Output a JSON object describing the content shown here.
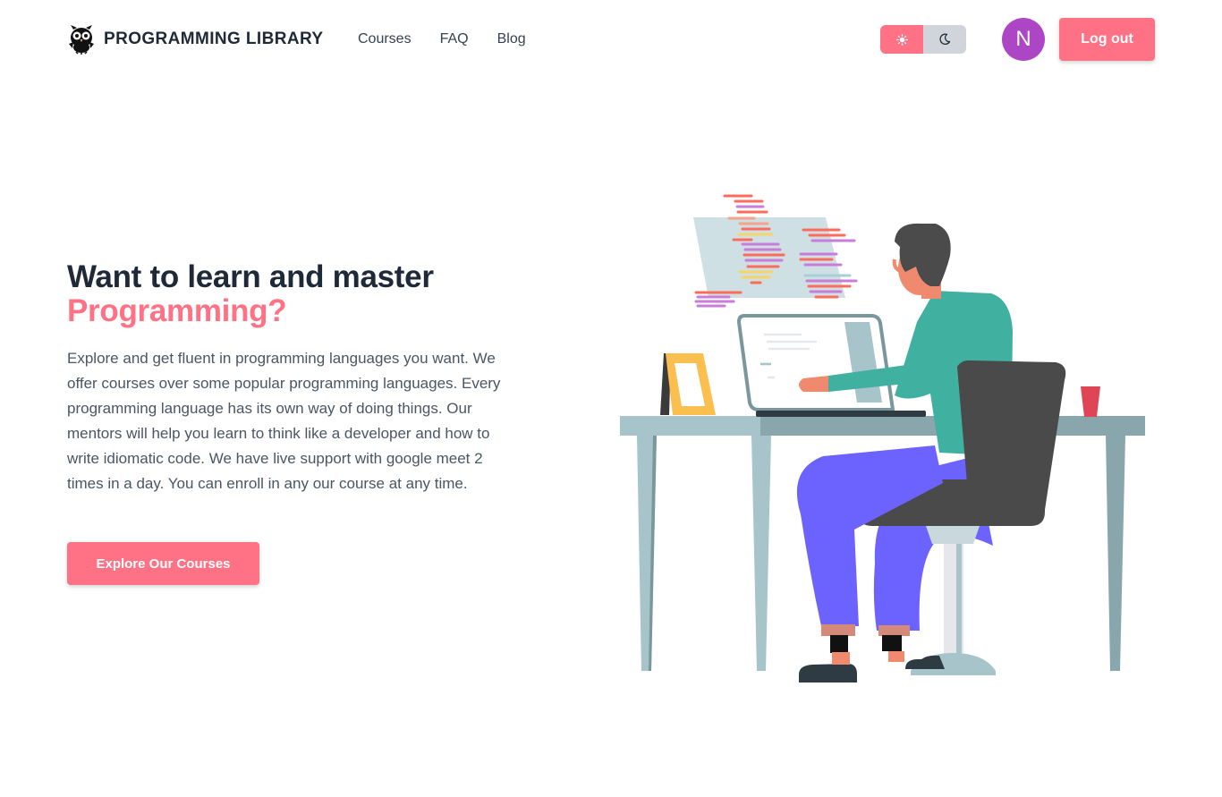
{
  "brand": {
    "title": "PROGRAMMING LIBRARY",
    "logo_icon": "owl-icon"
  },
  "nav": {
    "items": [
      {
        "label": "Courses"
      },
      {
        "label": "FAQ"
      },
      {
        "label": "Blog"
      }
    ]
  },
  "theme_toggle": {
    "light_icon": "sun-icon",
    "dark_icon": "moon-icon",
    "active": "light"
  },
  "user": {
    "avatar_initial": "N"
  },
  "actions": {
    "logout_label": "Log out"
  },
  "hero": {
    "title_line1": "Want to learn and master",
    "title_line2": "Programming?",
    "description": "Explore and get fluent in programming languages you want. We offer courses over some popular programming languages. Every programming language has its own way of doing things. Our mentors will help you learn to think like a developer and how to write idiomatic code. We have live support with google meet 2 times in a day. You can enroll in any our course at any time.",
    "cta_label": "Explore Our Courses"
  },
  "colors": {
    "accent": "#ff7285",
    "avatar": "#ad46c4",
    "heading": "#1f2937",
    "body_text": "#4b5563"
  }
}
